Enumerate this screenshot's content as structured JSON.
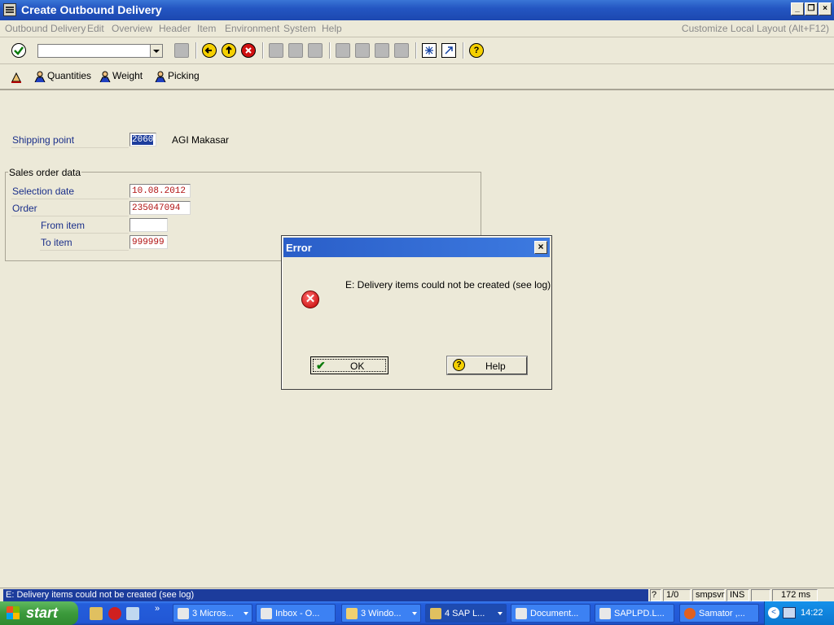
{
  "window": {
    "title": "Create Outbound Delivery"
  },
  "menu": {
    "items": [
      "Outbound Delivery",
      "Edit",
      "Overview",
      "Header",
      "Item",
      "Environment",
      "System",
      "Help"
    ],
    "customize": "Customize Local Layout (Alt+F12)"
  },
  "toolbar": {
    "command_field_value": "",
    "icons": [
      "enter-icon",
      "save-icon",
      "back-icon",
      "exit-icon",
      "cancel-icon",
      "print-icon",
      "find-icon",
      "find-next-icon",
      "first-page-icon",
      "previous-page-icon",
      "next-page-icon",
      "last-page-icon",
      "create-session-icon",
      "shortcut-icon",
      "help-icon"
    ]
  },
  "app_toolbar": {
    "buttons": [
      {
        "label": ""
      },
      {
        "label": "Quantities"
      },
      {
        "label": "Weight"
      },
      {
        "label": "Picking"
      }
    ]
  },
  "form": {
    "shipping_point": {
      "label": "Shipping point",
      "value": "2060",
      "description": "AGI Makasar"
    },
    "group_title": "Sales order data",
    "selection_date": {
      "label": "Selection date",
      "value": "10.08.2012"
    },
    "order": {
      "label": "Order",
      "value": "235047094"
    },
    "from_item": {
      "label": "From item",
      "value": ""
    },
    "to_item": {
      "label": "To item",
      "value": "999999"
    }
  },
  "dialog": {
    "title": "Error",
    "message": "E: Delivery items could not be created (see log)",
    "ok_label": "OK",
    "help_label": "Help"
  },
  "statusbar": {
    "message": "E: Delivery items could not be created (see log)",
    "session": "1/0",
    "server": "smpsvr",
    "mode": "INS",
    "time": "172 ms"
  },
  "taskbar": {
    "start_label": "start",
    "tasks": [
      {
        "label": "3 Micros..."
      },
      {
        "label": "Inbox - O..."
      },
      {
        "label": "3 Windo..."
      },
      {
        "label": "4 SAP L..."
      },
      {
        "label": "Document..."
      },
      {
        "label": "SAPLPD.L..."
      },
      {
        "label": "Samator ,..."
      }
    ],
    "clock": "14:22"
  },
  "colors": {
    "title_bar": "#2456c2",
    "field_text": "#b01010",
    "label_blue": "#1a2f8a",
    "status_highlight": "#1c3c9c"
  }
}
